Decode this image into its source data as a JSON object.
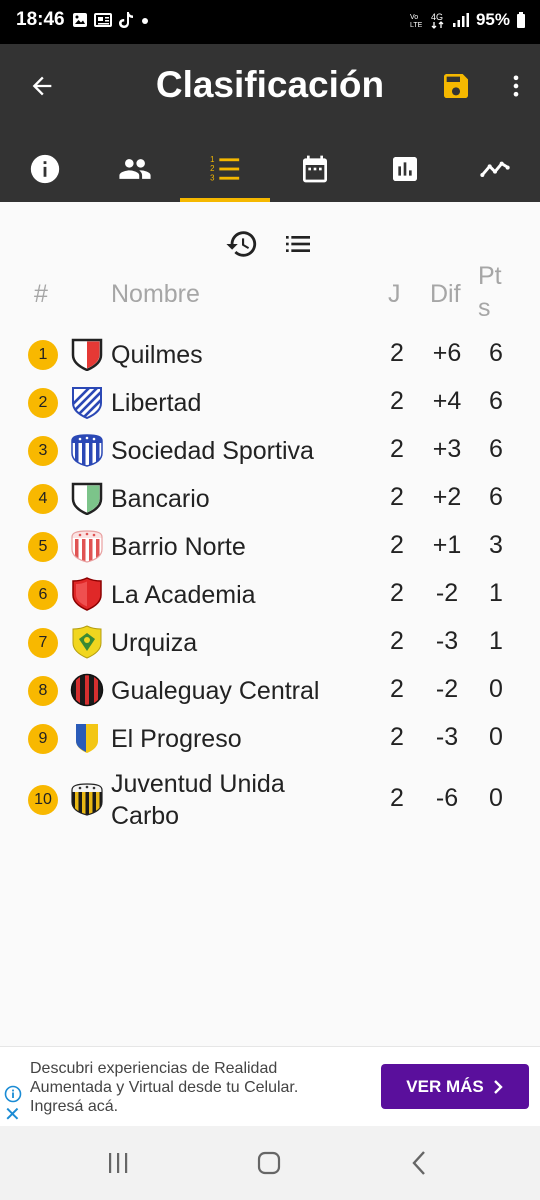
{
  "status_bar": {
    "time": "18:46",
    "battery": "95%",
    "network_label": "4G",
    "volte_label": "Vo LTE"
  },
  "app_bar": {
    "title": "Clasificación",
    "accent_color": "#f5b800",
    "background_color": "#333333",
    "tabs": [
      {
        "name": "info-icon",
        "selected": false
      },
      {
        "name": "players-icon",
        "selected": false
      },
      {
        "name": "standings-icon",
        "selected": true
      },
      {
        "name": "calendar-icon",
        "selected": false
      },
      {
        "name": "stats-icon",
        "selected": false
      },
      {
        "name": "trend-icon",
        "selected": false
      }
    ]
  },
  "table": {
    "headers": {
      "pos": "#",
      "name": "Nombre",
      "played": "J",
      "diff": "Dif",
      "points_line1": "Pt",
      "points_line2": "s"
    },
    "badge_color": "#f8b800",
    "rows": [
      {
        "pos": "1",
        "name": "Quilmes",
        "played": "2",
        "diff": "+6",
        "points": "6",
        "crest": "quilmes-crest"
      },
      {
        "pos": "2",
        "name": "Libertad",
        "played": "2",
        "diff": "+4",
        "points": "6",
        "crest": "libertad-crest"
      },
      {
        "pos": "3",
        "name": "Sociedad Sportiva",
        "played": "2",
        "diff": "+3",
        "points": "6",
        "crest": "sociedad-sportiva-crest"
      },
      {
        "pos": "4",
        "name": "Bancario",
        "played": "2",
        "diff": "+2",
        "points": "6",
        "crest": "bancario-crest"
      },
      {
        "pos": "5",
        "name": "Barrio Norte",
        "played": "2",
        "diff": "+1",
        "points": "3",
        "crest": "barrio-norte-crest"
      },
      {
        "pos": "6",
        "name": "La Academia",
        "played": "2",
        "diff": "-2",
        "points": "1",
        "crest": "la-academia-crest"
      },
      {
        "pos": "7",
        "name": "Urquiza",
        "played": "2",
        "diff": "-3",
        "points": "1",
        "crest": "urquiza-crest"
      },
      {
        "pos": "8",
        "name": "Gualeguay Central",
        "played": "2",
        "diff": "-2",
        "points": "0",
        "crest": "gualeguay-central-crest"
      },
      {
        "pos": "9",
        "name": "El Progreso",
        "played": "2",
        "diff": "-3",
        "points": "0",
        "crest": "el-progreso-crest"
      },
      {
        "pos": "10",
        "name": "Juventud Unida Carbo",
        "name_line1": "Juventud Unida",
        "name_line2": "Carbo",
        "played": "2",
        "diff": "-6",
        "points": "0",
        "crest": "juventud-unida-crest"
      }
    ]
  },
  "ad": {
    "text_line1": "Descubri experiencias de Realidad",
    "text_line2": "Aumentada y Virtual desde tu Celular.",
    "text_line3": "Ingresá acá.",
    "button_label": "VER MÁS",
    "button_color": "#5a0f9c"
  }
}
